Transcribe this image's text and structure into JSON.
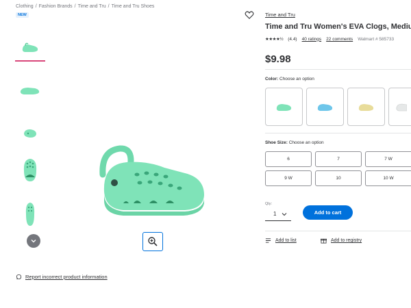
{
  "breadcrumb": [
    "Clothing",
    "Fashion Brands",
    "Time and Tru",
    "Time and Tru Shoes"
  ],
  "badge": "NEW",
  "product": {
    "brand": "Time and Tru",
    "title": "Time and Tru Women's EVA Clogs, Medium",
    "stars": "★★★★½",
    "rating": "(4.4)",
    "ratings_count": "40 ratings",
    "comments_count": "22 comments",
    "sku": "Walmart # 585733",
    "price": "$9.98"
  },
  "color": {
    "label": "Color:",
    "hint": "Choose an option"
  },
  "size": {
    "label": "Shoe Size:",
    "hint": "Choose an option",
    "options": [
      "6",
      "7",
      "7 W",
      "9 W",
      "10",
      "10 W"
    ]
  },
  "qty": {
    "label": "Qty:",
    "value": "1"
  },
  "add_to_cart": "Add to cart",
  "add_to_list": "Add to list",
  "add_to_registry": "Add to registry",
  "report_link": "Report incorrect product information",
  "colors": {
    "accent": "#0071dc",
    "shoe_mint": "#7fe3b8",
    "shoe_blue": "#6ec6ea",
    "shoe_yellow": "#e8dc9a",
    "shoe_white": "#eef0f0",
    "active_thumb": "#d9467a"
  }
}
